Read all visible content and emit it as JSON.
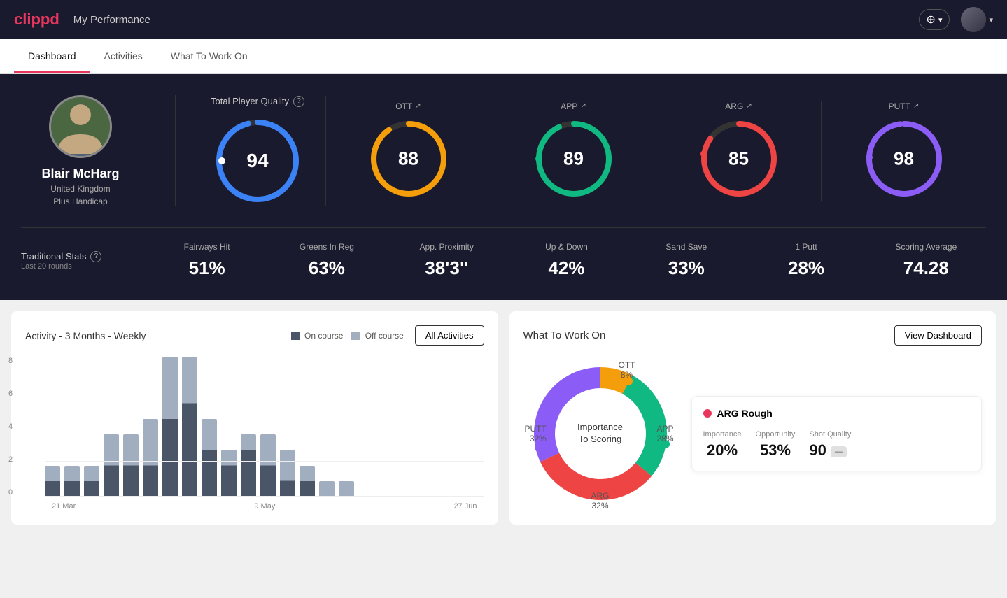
{
  "app": {
    "logo": "clippd",
    "nav_title": "My Performance",
    "add_button": "+",
    "dropdown_arrow": "▾"
  },
  "tabs": [
    {
      "id": "dashboard",
      "label": "Dashboard",
      "active": true
    },
    {
      "id": "activities",
      "label": "Activities",
      "active": false
    },
    {
      "id": "what-to-work-on",
      "label": "What To Work On",
      "active": false
    }
  ],
  "hero": {
    "player": {
      "name": "Blair McHarg",
      "country": "United Kingdom",
      "handicap": "Plus Handicap"
    },
    "total_quality": {
      "label": "Total Player Quality",
      "score": 94,
      "color": "#3b82f6"
    },
    "sub_scores": [
      {
        "id": "ott",
        "label": "OTT",
        "score": 88,
        "color": "#f59e0b",
        "trend": "↗"
      },
      {
        "id": "app",
        "label": "APP",
        "score": 89,
        "color": "#10b981",
        "trend": "↗"
      },
      {
        "id": "arg",
        "label": "ARG",
        "score": 85,
        "color": "#ef4444",
        "trend": "↗"
      },
      {
        "id": "putt",
        "label": "PUTT",
        "score": 98,
        "color": "#8b5cf6",
        "trend": "↗"
      }
    ],
    "traditional_stats": {
      "label": "Traditional Stats",
      "sublabel": "Last 20 rounds",
      "stats": [
        {
          "id": "fairways",
          "label": "Fairways Hit",
          "value": "51%"
        },
        {
          "id": "greens",
          "label": "Greens In Reg",
          "value": "63%"
        },
        {
          "id": "proximity",
          "label": "App. Proximity",
          "value": "38'3\""
        },
        {
          "id": "updown",
          "label": "Up & Down",
          "value": "42%"
        },
        {
          "id": "sandsave",
          "label": "Sand Save",
          "value": "33%"
        },
        {
          "id": "oneputt",
          "label": "1 Putt",
          "value": "28%"
        },
        {
          "id": "scoring",
          "label": "Scoring Average",
          "value": "74.28"
        }
      ]
    }
  },
  "activity_chart": {
    "title": "Activity - 3 Months - Weekly",
    "legend": [
      {
        "label": "On course",
        "color": "#4a5568"
      },
      {
        "label": "Off course",
        "color": "#a0aec0"
      }
    ],
    "all_activities_button": "All Activities",
    "y_labels": [
      "8",
      "6",
      "4",
      "2",
      "0"
    ],
    "x_labels": [
      "21 Mar",
      "9 May",
      "27 Jun"
    ],
    "bars": [
      {
        "on": 1,
        "off": 1
      },
      {
        "on": 1,
        "off": 1
      },
      {
        "on": 1,
        "off": 1
      },
      {
        "on": 2,
        "off": 2
      },
      {
        "on": 2,
        "off": 2
      },
      {
        "on": 2,
        "off": 3
      },
      {
        "on": 5,
        "off": 4
      },
      {
        "on": 6,
        "off": 3
      },
      {
        "on": 3,
        "off": 2
      },
      {
        "on": 2,
        "off": 1
      },
      {
        "on": 3,
        "off": 1
      },
      {
        "on": 2,
        "off": 2
      },
      {
        "on": 1,
        "off": 2
      },
      {
        "on": 1,
        "off": 1
      },
      {
        "on": 0,
        "off": 1
      },
      {
        "on": 0,
        "off": 1
      }
    ]
  },
  "work_on": {
    "title": "What To Work On",
    "view_dashboard_button": "View Dashboard",
    "donut_label": "Importance\nTo Scoring",
    "segments": [
      {
        "id": "ott",
        "label": "OTT",
        "pct": "8%",
        "color": "#f59e0b",
        "degrees": 28
      },
      {
        "id": "app",
        "label": "APP",
        "pct": "28%",
        "color": "#10b981",
        "degrees": 100
      },
      {
        "id": "arg",
        "label": "ARG",
        "pct": "32%",
        "color": "#ef4444",
        "degrees": 115
      },
      {
        "id": "putt",
        "label": "PUTT",
        "pct": "32%",
        "color": "#8b5cf6",
        "degrees": 115
      }
    ],
    "info_card": {
      "title": "ARG Rough",
      "dot_color": "#ef4444",
      "metrics": [
        {
          "label": "Importance",
          "value": "20%"
        },
        {
          "label": "Opportunity",
          "value": "53%"
        },
        {
          "label": "Shot Quality",
          "value": "90",
          "badge": true
        }
      ]
    }
  }
}
